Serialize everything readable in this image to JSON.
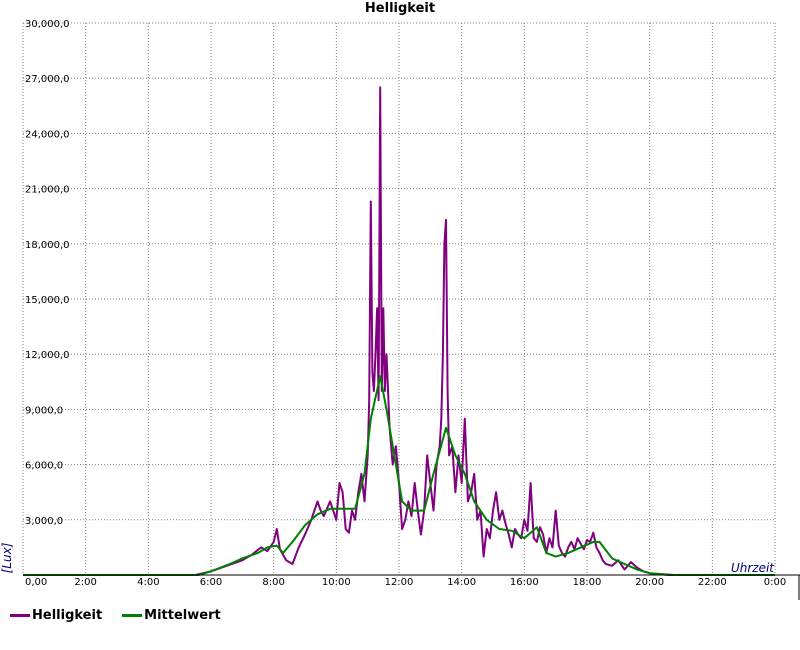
{
  "chart_data": {
    "type": "line",
    "title": "Helligkeit",
    "xlabel": "Uhrzeit",
    "ylabel": "[Lux]",
    "xlim": [
      0,
      24
    ],
    "ylim": [
      0,
      30000
    ],
    "grid": true,
    "legend_position": "bottom-left",
    "y_ticks": [
      "0,00",
      "3,000,0",
      "6,000,0",
      "9,000,0",
      "12,000,0",
      "15,000,0",
      "18,000,0",
      "21,000,0",
      "24,000,0",
      "27,000,0",
      "30,000,0"
    ],
    "x_ticks": [
      "0,00",
      "2:00",
      "4:00",
      "6:00",
      "8:00",
      "10:00",
      "12:00",
      "14:00",
      "16:00",
      "18:00",
      "20:00",
      "22:00",
      "0:00"
    ],
    "series": [
      {
        "name": "Helligkeit",
        "color": "#800080",
        "x": [
          0,
          5.5,
          6.0,
          6.5,
          7.0,
          7.3,
          7.6,
          7.8,
          8.0,
          8.1,
          8.2,
          8.4,
          8.6,
          8.8,
          9.0,
          9.2,
          9.4,
          9.5,
          9.6,
          9.8,
          10.0,
          10.1,
          10.2,
          10.3,
          10.4,
          10.5,
          10.6,
          10.7,
          10.8,
          10.9,
          11.0,
          11.05,
          11.1,
          11.15,
          11.2,
          11.25,
          11.3,
          11.35,
          11.4,
          11.45,
          11.5,
          11.55,
          11.6,
          11.7,
          11.8,
          11.9,
          12.0,
          12.1,
          12.2,
          12.3,
          12.4,
          12.5,
          12.6,
          12.7,
          12.8,
          12.9,
          13.0,
          13.1,
          13.2,
          13.3,
          13.35,
          13.4,
          13.45,
          13.5,
          13.55,
          13.6,
          13.7,
          13.8,
          13.9,
          14.0,
          14.1,
          14.2,
          14.3,
          14.4,
          14.5,
          14.6,
          14.7,
          14.8,
          14.9,
          15.0,
          15.1,
          15.2,
          15.3,
          15.4,
          15.5,
          15.6,
          15.7,
          15.8,
          15.9,
          16.0,
          16.1,
          16.2,
          16.3,
          16.4,
          16.5,
          16.6,
          16.7,
          16.8,
          16.9,
          17.0,
          17.1,
          17.2,
          17.3,
          17.4,
          17.5,
          17.6,
          17.7,
          17.8,
          17.9,
          18.0,
          18.1,
          18.2,
          18.3,
          18.4,
          18.5,
          18.6,
          18.8,
          19.0,
          19.2,
          19.4,
          19.6,
          19.8,
          20.0,
          20.3,
          20.6,
          21.0,
          24
        ],
        "y": [
          0,
          0,
          200,
          500,
          800,
          1100,
          1500,
          1300,
          1800,
          2500,
          1400,
          800,
          600,
          1500,
          2200,
          3000,
          4000,
          3500,
          3200,
          4000,
          3000,
          5000,
          4500,
          2500,
          2300,
          3500,
          3000,
          4500,
          5500,
          4000,
          6500,
          9500,
          20300,
          11000,
          10000,
          12000,
          14500,
          9500,
          26500,
          10000,
          14500,
          10000,
          12000,
          8000,
          6000,
          7000,
          5000,
          2500,
          3000,
          4000,
          3200,
          5000,
          3500,
          2200,
          3500,
          6500,
          5000,
          3500,
          6000,
          7000,
          8500,
          12000,
          18000,
          19300,
          10000,
          6500,
          7000,
          4500,
          6500,
          5000,
          8500,
          4000,
          4500,
          5500,
          3000,
          3500,
          1000,
          2500,
          2000,
          3500,
          4500,
          3000,
          3500,
          2800,
          2200,
          1500,
          2500,
          2200,
          2000,
          3000,
          2400,
          5000,
          2000,
          1800,
          2600,
          2200,
          1200,
          2000,
          1500,
          3500,
          1600,
          1200,
          1000,
          1500,
          1800,
          1400,
          2000,
          1700,
          1400,
          1900,
          1800,
          2300,
          1500,
          1200,
          800,
          600,
          500,
          800,
          300,
          700,
          400,
          200,
          100,
          50,
          0,
          0,
          0
        ]
      },
      {
        "name": "Mittelwert",
        "color": "#008000",
        "x": [
          0,
          5.6,
          6.0,
          6.6,
          7.0,
          7.5,
          7.8,
          8.1,
          8.3,
          8.6,
          9.0,
          9.4,
          9.8,
          10.2,
          10.6,
          10.9,
          11.1,
          11.4,
          11.6,
          11.9,
          12.1,
          12.4,
          12.8,
          13.1,
          13.5,
          13.8,
          14.1,
          14.4,
          14.8,
          15.2,
          15.6,
          16.0,
          16.4,
          16.7,
          17.0,
          17.4,
          17.8,
          18.2,
          18.4,
          18.8,
          19.2,
          19.6,
          20.0,
          20.4,
          20.8,
          24
        ],
        "y": [
          0,
          0,
          200,
          600,
          900,
          1200,
          1500,
          1600,
          1200,
          1800,
          2700,
          3300,
          3600,
          3600,
          3600,
          5500,
          8500,
          10800,
          9000,
          6000,
          4000,
          3500,
          3500,
          5500,
          8000,
          6500,
          5500,
          4000,
          3000,
          2500,
          2400,
          2000,
          2600,
          1200,
          1000,
          1200,
          1500,
          1800,
          1800,
          900,
          600,
          300,
          100,
          50,
          0,
          0
        ]
      }
    ]
  }
}
